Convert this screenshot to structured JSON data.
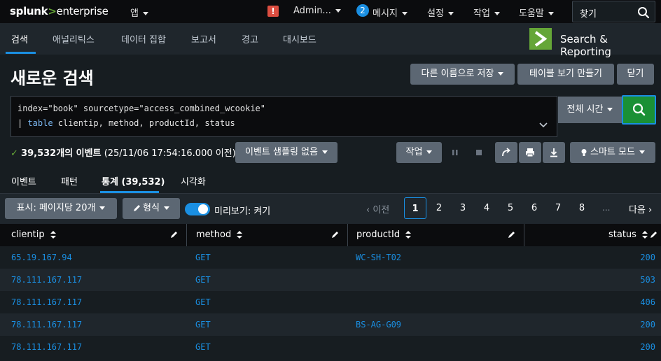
{
  "topbar": {
    "logo_splunk": "splunk",
    "logo_gt": ">",
    "logo_enterprise": "enterprise",
    "app_menu": "앱",
    "alert_mark": "!",
    "admin_menu": "Admin...",
    "messages_count": "2",
    "messages_menu": "메시지",
    "settings_menu": "설정",
    "activity_menu": "작업",
    "help_menu": "도움말",
    "find_label": "찾기"
  },
  "appbar": {
    "tabs": [
      "검색",
      "애널리틱스",
      "데이터 집합",
      "보고서",
      "경고",
      "대시보드"
    ],
    "app_name": "Search & Reporting",
    "app_logo_glyph": ">"
  },
  "page": {
    "title": "새로운 검색",
    "save_as": "다른 이름으로 저장",
    "create_table_view": "테이블 보기 만들기",
    "close": "닫기"
  },
  "search": {
    "line1": "index=\"book\" sourcetype=\"access_combined_wcookie\"",
    "line2_pipe": "| ",
    "line2_cmd": "table",
    "line2_rest": " clientip, method, productId, status",
    "time_range": "전체 시간"
  },
  "status": {
    "check": "✓",
    "count_text": "39,532개의 이벤트",
    "time_text": "(25/11/06 17:54:16.000 이전)",
    "sampling": "이벤트 샘플링 없음",
    "job_menu": "작업",
    "mode": "스마트 모드"
  },
  "result_tabs": [
    "이벤트",
    "패턴",
    "통계 (39,532)",
    "시각화"
  ],
  "controls": {
    "per_page": "표시: 페이지당 20개",
    "format": "형식",
    "preview": "미리보기: 켜기",
    "prev": "이전",
    "pages": [
      "1",
      "2",
      "3",
      "4",
      "5",
      "6",
      "7",
      "8"
    ],
    "ellipsis": "...",
    "next": "다음"
  },
  "table": {
    "columns": [
      "clientip",
      "method",
      "productId",
      "status"
    ],
    "rows": [
      {
        "clientip": "65.19.167.94",
        "method": "GET",
        "productId": "WC-SH-T02",
        "status": "200"
      },
      {
        "clientip": "78.111.167.117",
        "method": "GET",
        "productId": "",
        "status": "503"
      },
      {
        "clientip": "78.111.167.117",
        "method": "GET",
        "productId": "",
        "status": "406"
      },
      {
        "clientip": "78.111.167.117",
        "method": "GET",
        "productId": "BS-AG-G09",
        "status": "200"
      },
      {
        "clientip": "78.111.167.117",
        "method": "GET",
        "productId": "",
        "status": "200"
      }
    ]
  },
  "colors": {
    "accent": "#1a8fe2",
    "splunk_green": "#65a637",
    "search_button": "#1a9035",
    "alert": "#dc4e41"
  }
}
